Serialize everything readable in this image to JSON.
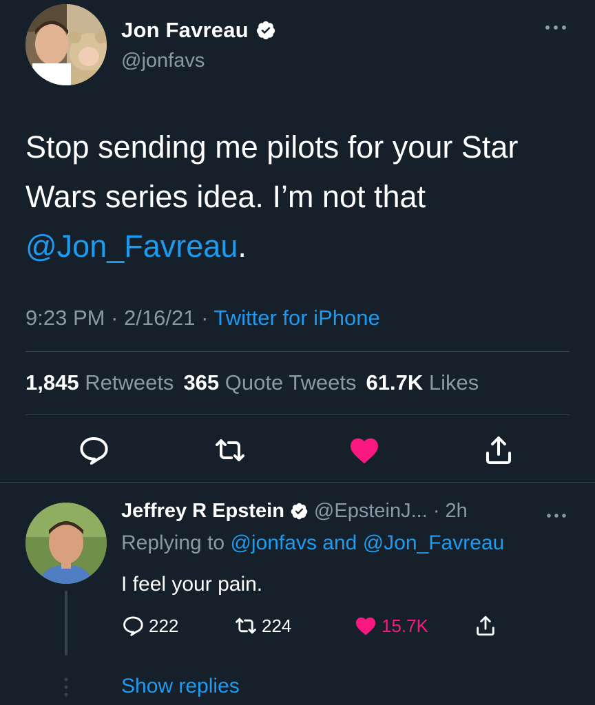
{
  "tweet": {
    "author": {
      "name": "Jon Favreau",
      "handle": "@jonfavs",
      "verified": true,
      "avatar_icon": "avatar-photo"
    },
    "text_part1": "Stop sending me pilots for your Star Wars series idea. I’m not that",
    "mention": "@Jon_Favreau",
    "text_end": ".",
    "time": "9:23 PM",
    "date": "2/16/21",
    "separator": "·",
    "source": "Twitter for iPhone",
    "stats": {
      "retweets_count": "1,845",
      "retweets_label": "Retweets",
      "quotes_count": "365",
      "quotes_label": "Quote Tweets",
      "likes_count": "61.7K",
      "likes_label": "Likes"
    },
    "actions": {
      "reply_icon": "reply-icon",
      "retweet_icon": "retweet-icon",
      "like_icon": "heart-icon",
      "like_state": "liked",
      "share_icon": "share-icon"
    }
  },
  "reply": {
    "author": {
      "name": "Jeffrey R Epstein",
      "handle": "@EpsteinJ...",
      "time": "2h",
      "verified": true
    },
    "replying_to_label": "Replying to",
    "replying_to_1": "@jonfavs",
    "replying_and": "and",
    "replying_to_2": "@Jon_Favreau",
    "text": "I feel your pain.",
    "counts": {
      "replies": "222",
      "retweets": "224",
      "likes": "15.7K"
    },
    "show_replies": "Show replies"
  },
  "colors": {
    "background": "#15202b",
    "accent": "#1d9bf0",
    "muted": "#8b98a5",
    "like": "#f91880",
    "divider": "#38444d"
  }
}
